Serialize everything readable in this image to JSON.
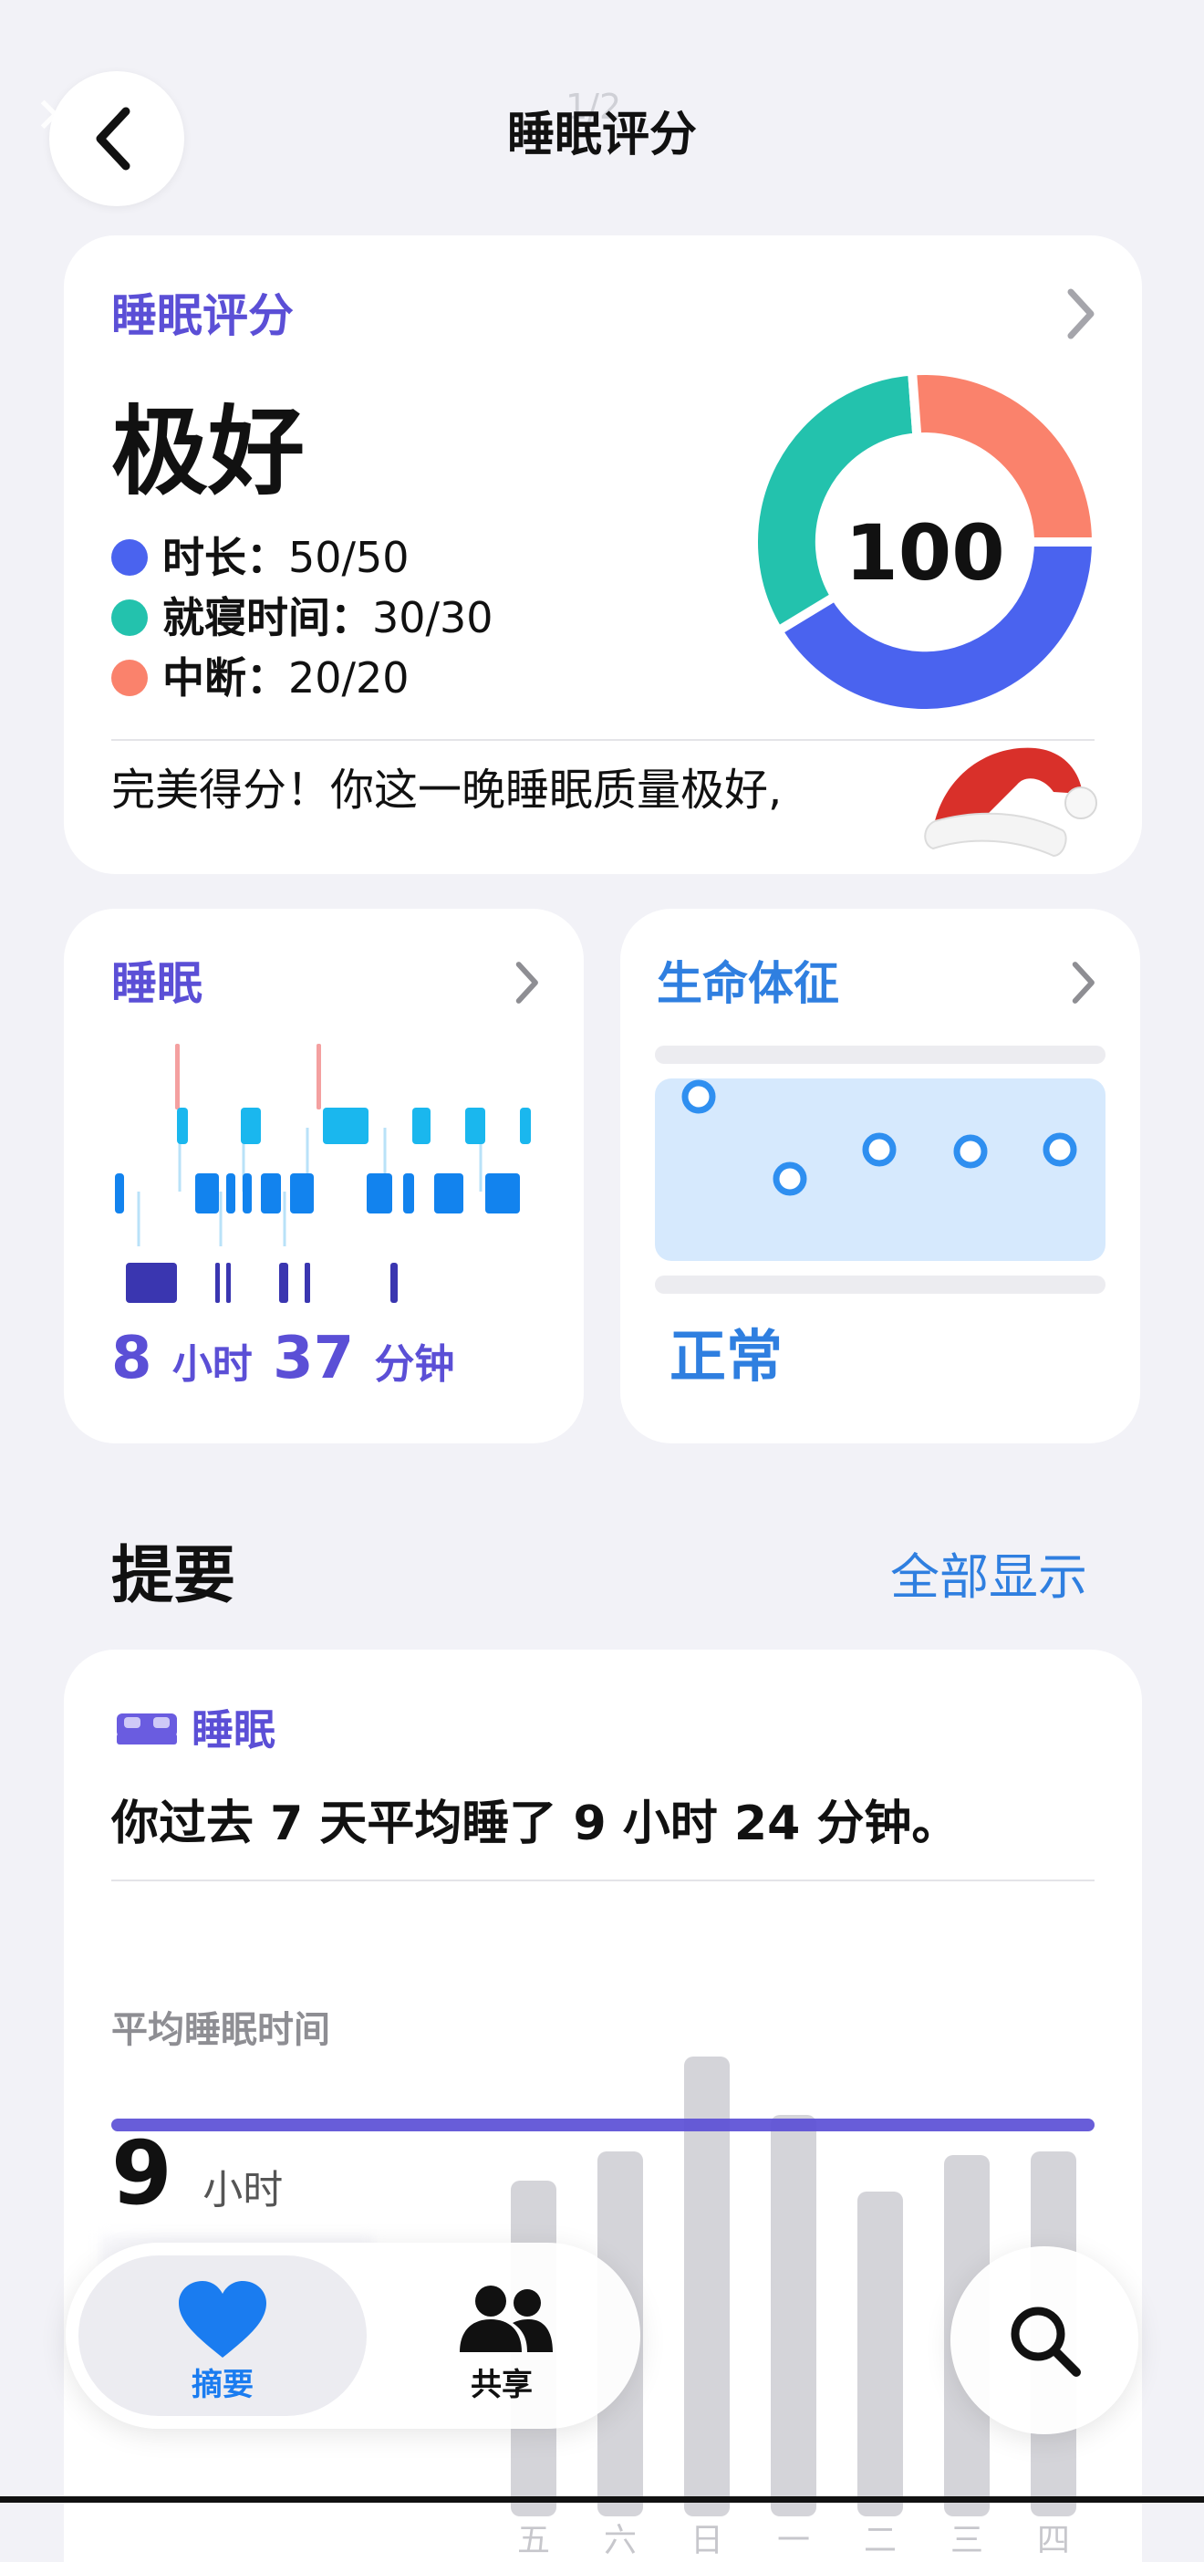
{
  "header": {
    "title": "睡眠评分",
    "page_counter": "1/2",
    "close_symbol": "✕",
    "back_icon": "chevron-left-icon"
  },
  "score_card": {
    "title": "睡眠评分",
    "rating": "极好",
    "score": "100",
    "metrics": [
      {
        "label": "时长：",
        "value": "50/50",
        "color": "#4a63ef"
      },
      {
        "label": "就寝时间：",
        "value": "30/30",
        "color": "#23c2ad"
      },
      {
        "label": "中断：",
        "value": "20/20",
        "color": "#fa826c"
      }
    ],
    "message": "完美得分！你这一晚睡眠质量极好,",
    "decoration": "santa-hat-icon"
  },
  "sleep_card": {
    "title": "睡眠",
    "hours": "8",
    "hours_unit": "小时",
    "minutes": "37",
    "minutes_unit": "分钟",
    "colors": {
      "rem": "#1ab7ee",
      "core": "#1283ee",
      "deep": "#3a36b0",
      "awake": "#f28b8b"
    }
  },
  "vitals_card": {
    "title": "生命体征",
    "status": "正常",
    "point_count_note": "5"
  },
  "summary": {
    "heading": "提要",
    "show_all": "全部显示",
    "sleep_card": {
      "category": "睡眠",
      "sentence": "你过去 7 天平均睡了 9 小时 24 分钟。",
      "avg_label": "平均睡眠时间",
      "avg_hours": "9",
      "avg_hours_unit": "小时",
      "days": [
        "五",
        "六",
        "日",
        "一",
        "二",
        "三",
        "四"
      ]
    }
  },
  "tabbar": {
    "summary_label": "摘要",
    "sharing_label": "共享",
    "accent": "#1a7cf0"
  },
  "chart_data": {
    "type": "bar",
    "categories": [
      "五",
      "六",
      "日",
      "一",
      "二",
      "三",
      "四"
    ],
    "series": [
      {
        "values": [
          9.2,
          10.0,
          12.6,
          11.0,
          8.9,
          9.9,
          10.0
        ]
      }
    ],
    "average_line": 9.4,
    "ylabel": "",
    "xlabel": ""
  }
}
